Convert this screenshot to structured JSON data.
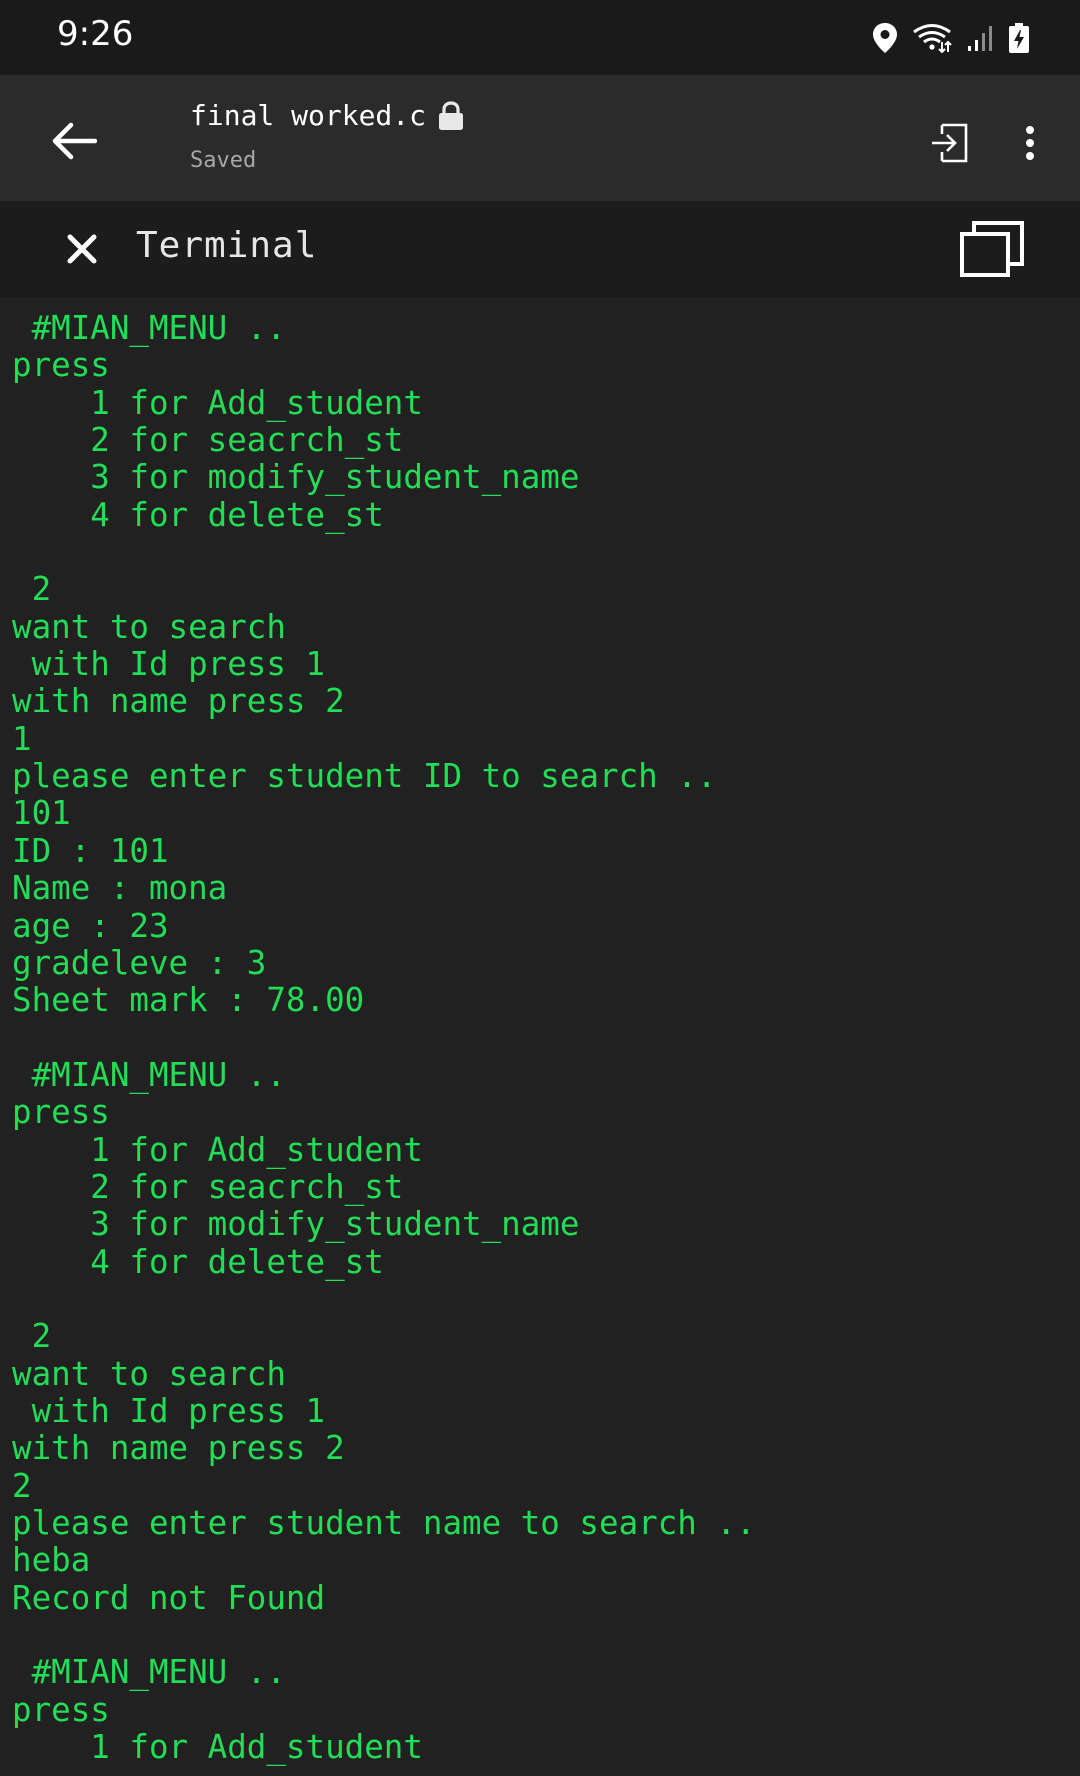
{
  "status_bar": {
    "time": "9:26",
    "icons": [
      "location-icon",
      "wifi-icon",
      "signal-icon",
      "battery-charging-icon"
    ]
  },
  "app_bar": {
    "back_icon": "arrow-left-icon",
    "file_name": "final worked.c",
    "lock_icon": "lock-icon",
    "save_status": "Saved",
    "exit_icon": "exit-to-app-icon",
    "more_icon": "more-vert-icon"
  },
  "terminal_bar": {
    "close_icon": "close-icon",
    "title": "Terminal",
    "window_icon": "window-restore-icon"
  },
  "colors": {
    "terminal_text": "#22dd55",
    "terminal_bg": "#212121",
    "app_bar_bg": "#2b2b2b",
    "status_bar_bg": "#1a1a1a"
  },
  "terminal": {
    "lines": [
      " #MIAN_MENU ..",
      "press",
      "    1 for Add_student",
      "    2 for seacrch_st",
      "    3 for modify_student_name",
      "    4 for delete_st",
      "",
      " 2",
      "want to search",
      " with Id press 1",
      "with name press 2",
      "1",
      "please enter student ID to search ..",
      "101",
      "ID : 101",
      "Name : mona",
      "age : 23",
      "gradeleve : 3",
      "Sheet mark : 78.00",
      "",
      " #MIAN_MENU ..",
      "press",
      "    1 for Add_student",
      "    2 for seacrch_st",
      "    3 for modify_student_name",
      "    4 for delete_st",
      "",
      " 2",
      "want to search",
      " with Id press 1",
      "with name press 2",
      "2",
      "please enter student name to search ..",
      "heba",
      "Record not Found",
      "",
      " #MIAN_MENU ..",
      "press",
      "    1 for Add_student"
    ]
  }
}
